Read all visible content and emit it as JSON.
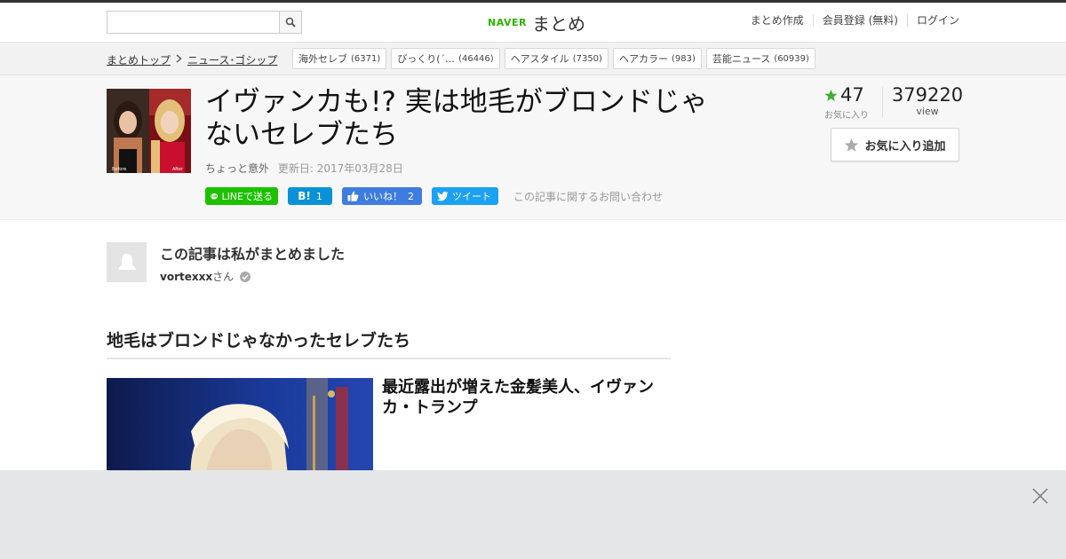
{
  "header": {
    "search": {
      "placeholder": "",
      "value": ""
    },
    "logo": {
      "brand": "NAVER",
      "product": "まとめ"
    },
    "nav": [
      "まとめ作成",
      "会員登録 (無料)",
      "ログイン"
    ]
  },
  "breadcrumb": {
    "items": [
      "まとめトップ",
      "ニュース･ゴシップ"
    ],
    "tags": [
      {
        "label": "海外セレブ",
        "count": "(6371)"
      },
      {
        "label": "びっくり(´…",
        "count": "(46446)"
      },
      {
        "label": "ヘアスタイル",
        "count": "(7350)"
      },
      {
        "label": "ヘアカラー",
        "count": "(983)"
      },
      {
        "label": "芸能ニュース",
        "count": "(60939)"
      }
    ]
  },
  "article": {
    "title_line1": "イヴァンカも!? 実は地毛がブロンドじゃ",
    "title_line2": "ないセレブたち",
    "category": "ちょっと意外",
    "updated": "更新日: 2017年03月28日",
    "thumb_before": "Before",
    "thumb_after": "After",
    "share": {
      "line": "LINEで送る",
      "hatena_count": "1",
      "facebook": "いいね！",
      "facebook_count": "2",
      "tweet": "ツイート"
    },
    "contact": "この記事に関するお問い合わせ",
    "favorites": "47",
    "favorites_label": "お気に入り",
    "views": "379220",
    "views_label": "view",
    "fav_button": "お気に入り追加"
  },
  "author": {
    "heading": "この記事は私がまとめました",
    "name": "vortexxx",
    "suffix": "さん"
  },
  "section": {
    "heading": "地毛はブロンドじゃなかったセレブたち",
    "item_title": "最近露出が増えた金髪美人、イヴァンカ・トランプ"
  },
  "colors": {
    "naver_green": "#2db400",
    "line_green": "#1dc100",
    "hatena_blue": "#0a92d6",
    "facebook_blue": "#3f7ce0",
    "twitter_blue": "#1da1f2",
    "star_green": "#3cb034"
  }
}
